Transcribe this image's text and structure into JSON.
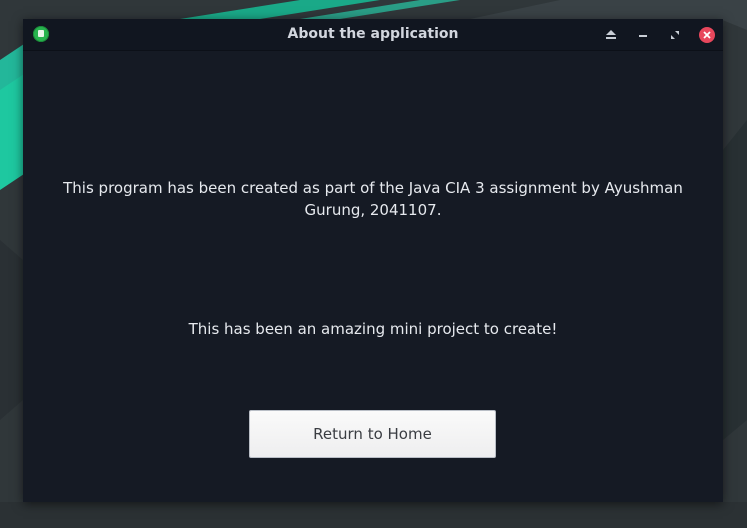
{
  "window": {
    "title": "About the application"
  },
  "icons": {
    "app": "app-icon",
    "keep_above": "eject-icon",
    "minimize": "minimize-icon",
    "maximize": "restore-icon",
    "close": "close-icon"
  },
  "content": {
    "line1": "This program has been created as part of the Java CIA 3 assignment by Ayushman",
    "line2": "Gurung, 2041107.",
    "line3": "This has been an amazing mini project to create!",
    "home_button": "Return to Home"
  },
  "colors": {
    "window_bg": "#151a24",
    "titlebar_bg": "#111620",
    "text": "#e6e9ee",
    "close_button": "#e8475c",
    "app_icon": "#27b34e",
    "wallpaper_accent": "#1ec8a0"
  }
}
